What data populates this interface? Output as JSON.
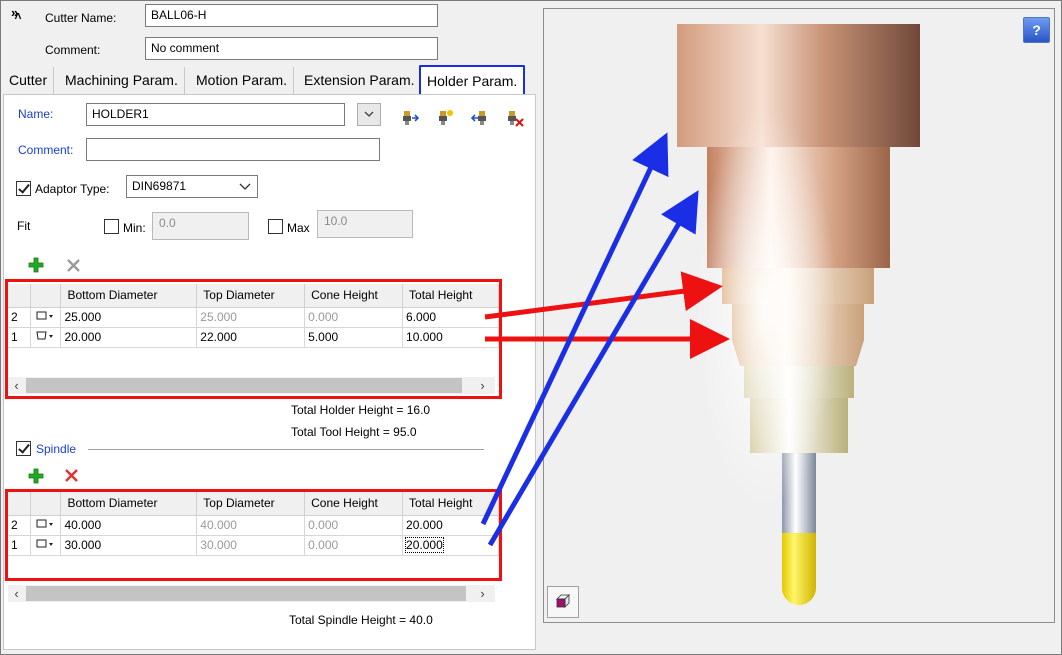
{
  "header": {
    "cutter_name_label": "Cutter Name:",
    "cutter_name_value": "BALL06-H",
    "comment_label": "Comment:",
    "comment_value": "No comment"
  },
  "tabs": [
    {
      "label": "Cutter"
    },
    {
      "label": "Machining Param."
    },
    {
      "label": "Motion Param."
    },
    {
      "label": "Extension Param."
    },
    {
      "label": "Holder Param.",
      "active": true
    }
  ],
  "holder": {
    "name_label": "Name:",
    "name_value": "HOLDER1",
    "comment_label": "Comment:",
    "comment_value": "",
    "adaptor_label": "Adaptor Type:",
    "adaptor_checked": true,
    "adaptor_value": "DIN69871",
    "fit_label": "Fit",
    "min_label": "Min:",
    "min_value": "0.0",
    "max_label": "Max",
    "max_value": "10.0"
  },
  "columns": [
    "Bottom Diameter",
    "Top Diameter",
    "Cone Height",
    "Total Height"
  ],
  "holder_rows": [
    {
      "idx": "2",
      "bottom": "25.000",
      "top": "25.000",
      "cone": "0.000",
      "total": "6.000"
    },
    {
      "idx": "1",
      "bottom": "20.000",
      "top": "22.000",
      "cone": "5.000",
      "total": "10.000"
    }
  ],
  "totals": {
    "holder_height": "Total Holder Height = 16.0",
    "tool_height": "Total Tool Height = 95.0",
    "spindle_height": "Total Spindle Height = 40.0"
  },
  "spindle": {
    "label": "Spindle",
    "checked": true
  },
  "spindle_rows": [
    {
      "idx": "2",
      "bottom": "40.000",
      "top": "40.000",
      "cone": "0.000",
      "total": "20.000"
    },
    {
      "idx": "1",
      "bottom": "30.000",
      "top": "30.000",
      "cone": "0.000",
      "total": "20.000"
    }
  ],
  "preview": {
    "help_glyph": "?"
  },
  "colors": {
    "annotation_red": "#ee1111",
    "annotation_blue": "#1a2ee6",
    "label_blue": "#1a3fd4"
  }
}
